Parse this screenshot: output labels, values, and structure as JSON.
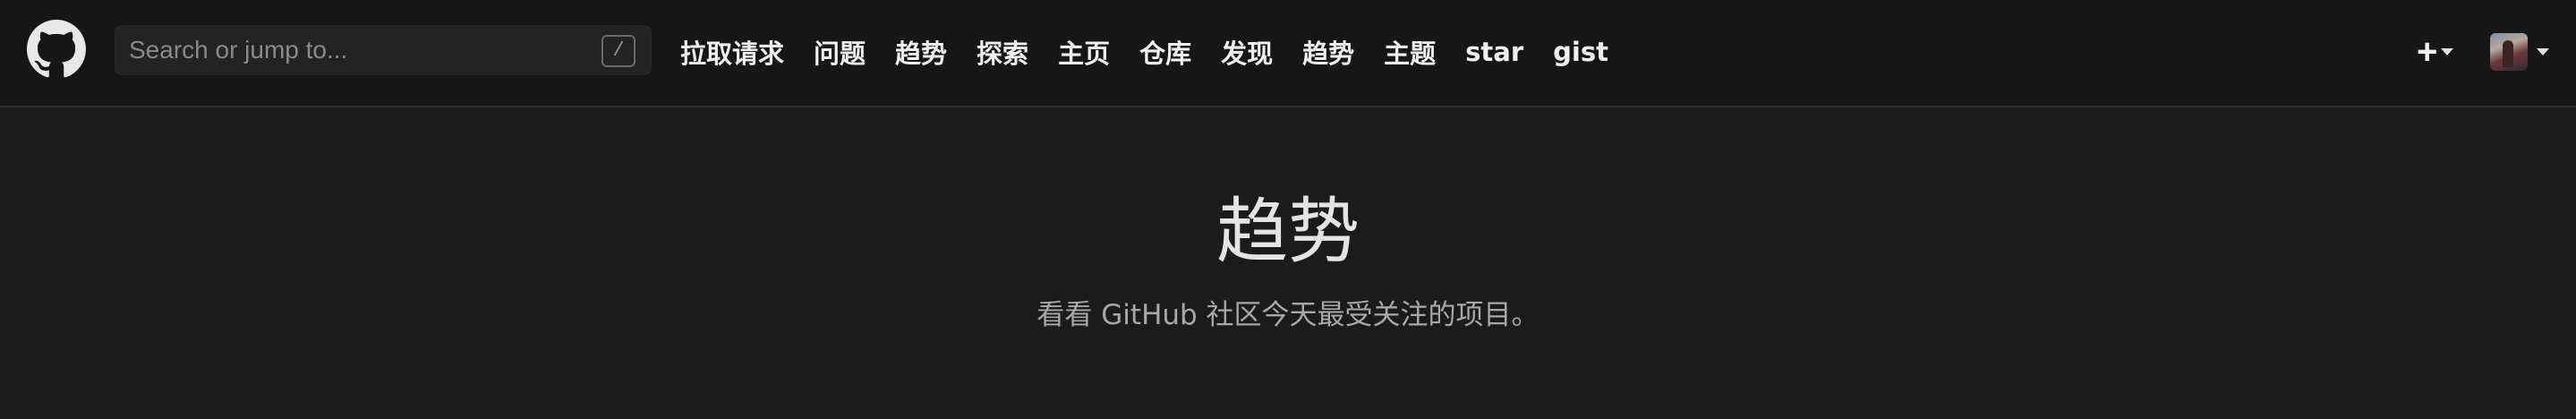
{
  "header": {
    "logo_icon": "github-octocat-icon",
    "search": {
      "placeholder": "Search or jump to...",
      "value": "",
      "shortcut_key": "/"
    },
    "nav_items": [
      "拉取请求",
      "问题",
      "趋势",
      "探索",
      "主页",
      "仓库",
      "发现",
      "趋势",
      "主题",
      "star",
      "gist"
    ],
    "plus_menu_label": "+",
    "plus_icon": "plus-icon",
    "avatar_icon": "user-avatar"
  },
  "hero": {
    "title": "趋势",
    "subtitle": "看看 GitHub 社区今天最受关注的项目。"
  },
  "colors": {
    "background": "#1b1b1b",
    "header_background": "#161616",
    "text_primary": "#f0f0f0",
    "text_muted": "#a8a8a8"
  }
}
